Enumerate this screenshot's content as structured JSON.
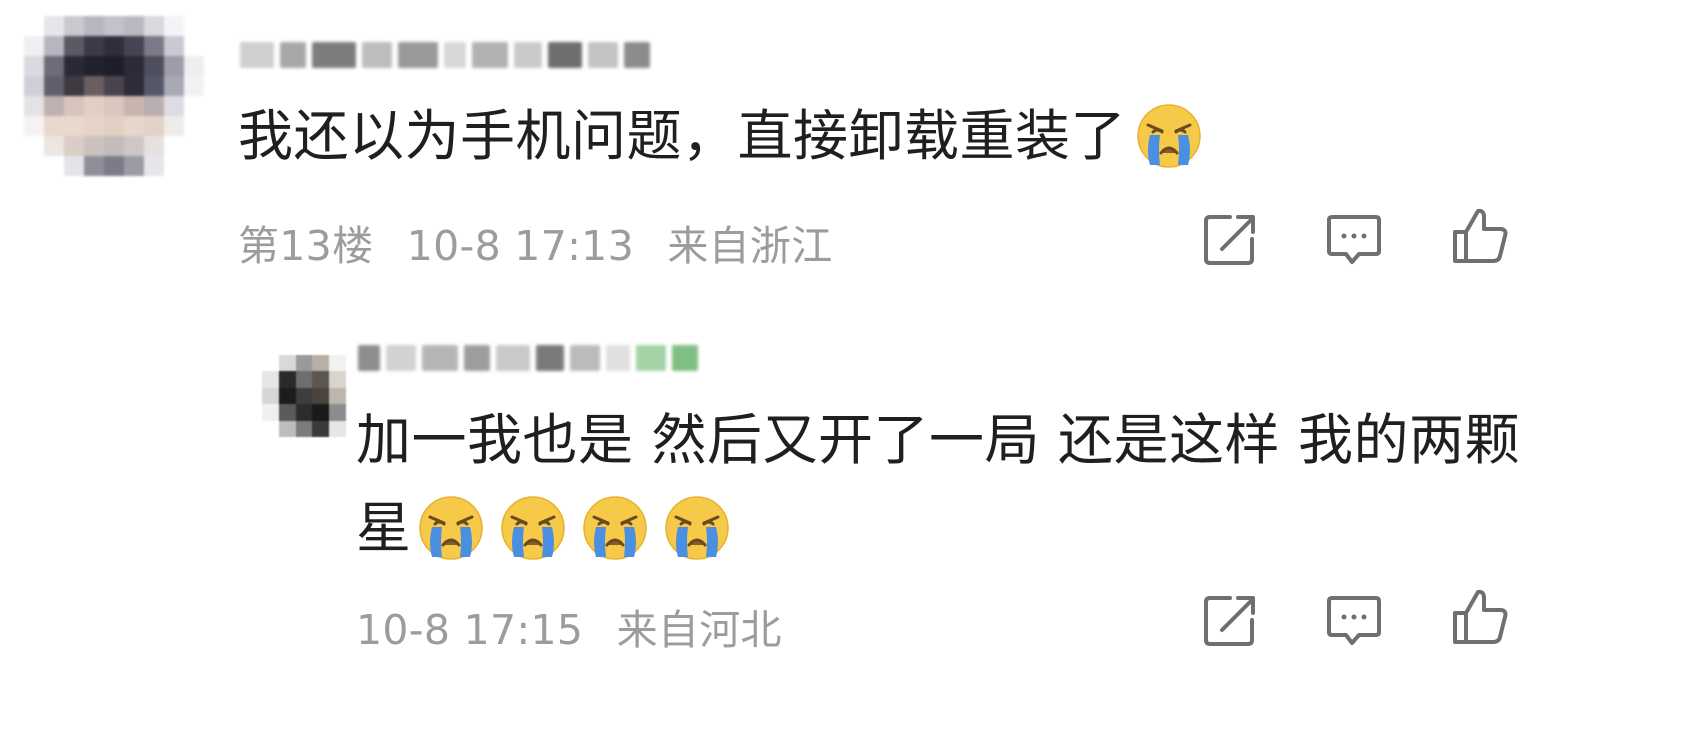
{
  "comments": [
    {
      "text": "我还以为手机问题，直接卸载重装了",
      "emoji_count": 1,
      "meta": {
        "floor": "第13楼",
        "time": "10-8 17:13",
        "location": "来自浙江"
      }
    }
  ],
  "reply": {
    "text_line1": "加一我也是 然后又开了一局 还是这样 我的两颗",
    "text_line2": "星",
    "emoji_count": 4,
    "meta": {
      "time": "10-8 17:15",
      "location": "来自河北"
    }
  },
  "icons": {
    "share": "share-icon",
    "comment": "comment-icon",
    "like": "thumbs-up-icon",
    "emoji": "loudly-crying-face-emoji"
  },
  "colors": {
    "text": "#1f1f1f",
    "meta": "#9c9c9c",
    "icon": "#6f6f6f",
    "emoji_face": "#f7c948",
    "emoji_tears": "#4a90e2"
  }
}
